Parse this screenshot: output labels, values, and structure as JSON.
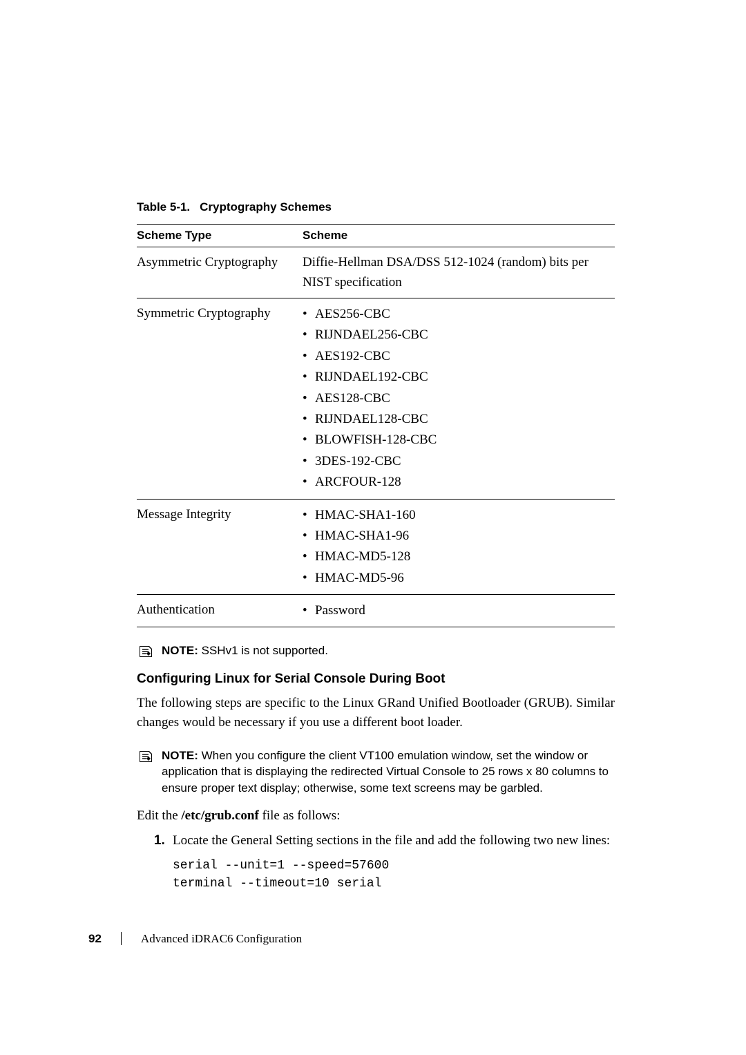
{
  "table": {
    "caption_number": "Table 5-1.",
    "caption_title": "Cryptography Schemes",
    "headers": {
      "col1": "Scheme Type",
      "col2": "Scheme"
    },
    "rows": {
      "asym": {
        "type": "Asymmetric Cryptography",
        "text": "Diffie-Hellman DSA/DSS 512-1024 (random) bits per NIST specification"
      },
      "sym": {
        "type": "Symmetric Cryptography",
        "items": {
          "0": "AES256-CBC",
          "1": "RIJNDAEL256-CBC",
          "2": "AES192-CBC",
          "3": "RIJNDAEL192-CBC",
          "4": "AES128-CBC",
          "5": "RIJNDAEL128-CBC",
          "6": "BLOWFISH-128-CBC",
          "7": "3DES-192-CBC",
          "8": "ARCFOUR-128"
        }
      },
      "msgint": {
        "type": "Message Integrity",
        "items": {
          "0": "HMAC-SHA1-160",
          "1": "HMAC-SHA1-96",
          "2": "HMAC-MD5-128",
          "3": "HMAC-MD5-96"
        }
      },
      "auth": {
        "type": "Authentication",
        "items": {
          "0": "Password"
        }
      }
    }
  },
  "notes": {
    "note1_label": "NOTE:",
    "note1_text": " SSHv1 is not supported.",
    "note2_label": "NOTE:",
    "note2_text": " When you configure the client VT100 emulation window, set the window or application that is displaying the redirected Virtual Console to 25 rows x 80 columns to ensure proper text display; otherwise, some text screens may be garbled."
  },
  "section": {
    "heading": "Configuring Linux for Serial Console During Boot",
    "para1": "The following steps are specific to the Linux GRand Unified Bootloader (GRUB). Similar changes would be necessary if you use a different boot loader.",
    "edit_line_pre": "Edit the ",
    "edit_line_file": "/etc/grub.conf",
    "edit_line_post": " file as follows:",
    "step1": "Locate the General Setting sections in the file and add the following two new lines:",
    "code": "serial --unit=1 --speed=57600\nterminal --timeout=10 serial"
  },
  "footer": {
    "page": "92",
    "title": "Advanced iDRAC6 Configuration"
  }
}
